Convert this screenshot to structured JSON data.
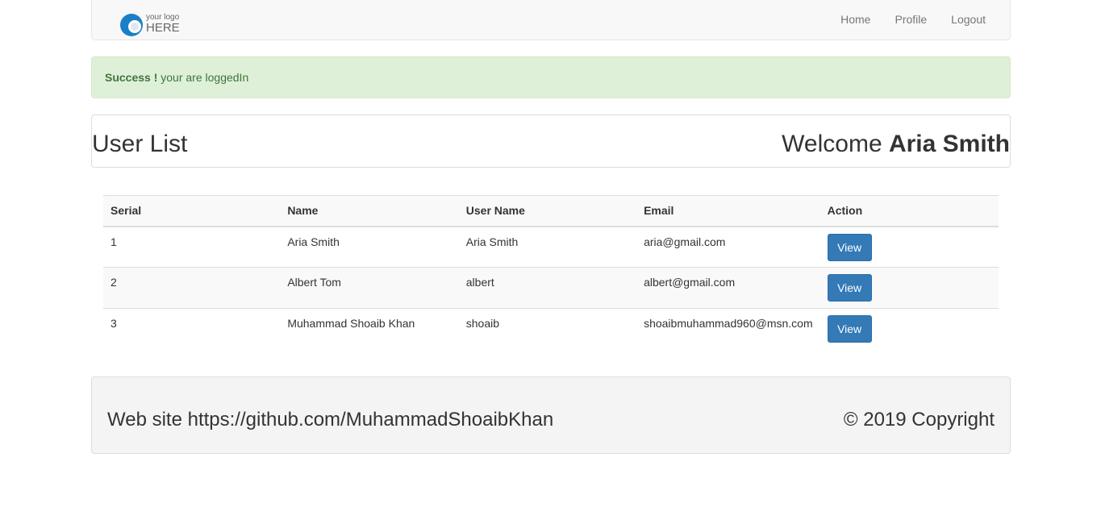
{
  "navbar": {
    "logo": {
      "small_text": "your logo",
      "big_text": "HERE",
      "accent": "#1a7fc8"
    },
    "links": [
      {
        "label": "Home"
      },
      {
        "label": "Profile"
      },
      {
        "label": "Logout"
      }
    ]
  },
  "alert": {
    "strong": "Success !",
    "message": " your are loggedIn",
    "bg_color": "#dff0d8",
    "text_color": "#3c763d"
  },
  "heading": {
    "title": "User List",
    "welcome_prefix": "Welcome ",
    "user_name": "Aria Smith"
  },
  "table": {
    "columns": [
      "Serial",
      "Name",
      "User Name",
      "Email",
      "Action"
    ],
    "rows": [
      {
        "serial": "1",
        "name": "Aria Smith",
        "username": "Aria Smith",
        "email": "aria@gmail.com",
        "action": "View"
      },
      {
        "serial": "2",
        "name": "Albert Tom",
        "username": "albert",
        "email": "albert@gmail.com",
        "action": "View"
      },
      {
        "serial": "3",
        "name": "Muhammad Shoaib Khan",
        "username": "shoaib",
        "email": "shoaibmuhammad960@msn.com",
        "action": "View"
      }
    ],
    "button_color": "#337ab7"
  },
  "footer": {
    "left": "Web site https://github.com/MuhammadShoaibKhan",
    "right": "© 2019 Copyright"
  }
}
